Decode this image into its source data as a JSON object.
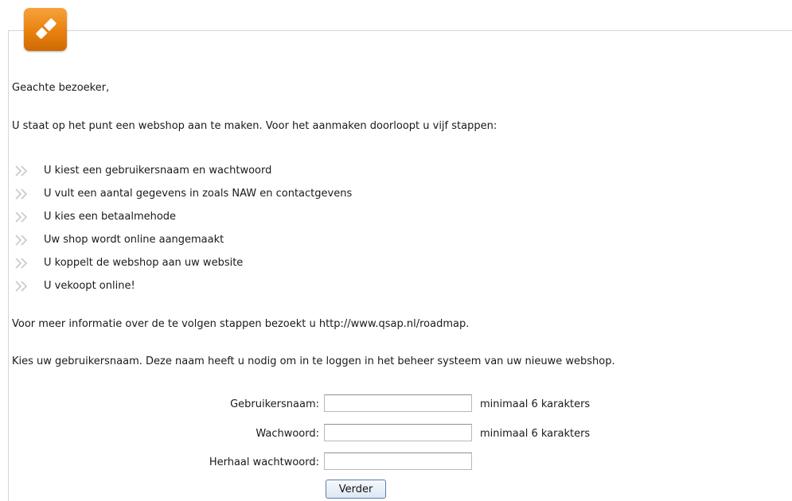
{
  "greeting": "Geachte bezoeker,",
  "intro": "U staat op het punt een webshop aan te maken. Voor het aanmaken doorloopt u vijf stappen:",
  "steps": [
    "U kiest een gebruikersnaam en wachtwoord",
    "U vult een aantal gegevens in zoals NAW en contactgevens",
    "U kies een betaalmehode",
    "Uw shop wordt online aangemaakt",
    "U koppelt de webshop aan uw website",
    "U vekoopt online!"
  ],
  "info": "Voor meer informatie over de te volgen stappen bezoekt u http://www.qsap.nl/roadmap.",
  "instruction": "Kies uw gebruikersnaam. Deze naam heeft u nodig om in te loggen in het beheer systeem van uw nieuwe webshop.",
  "form": {
    "username_label": "Gebruikersnaam:",
    "username_value": "",
    "username_hint": "minimaal 6 karakters",
    "password_label": "Wachwoord:",
    "password_value": "",
    "password_hint": "minimaal 6 karakters",
    "repeat_label": "Herhaal wachtwoord:",
    "repeat_value": "",
    "submit_label": "Verder"
  },
  "colors": {
    "logo": "#e8810f",
    "frame": "#d7d7d7",
    "button_border": "#5a7fae"
  },
  "icons": {
    "logo": "pencil-logo-icon",
    "bullet": "double-chevron-icon"
  }
}
